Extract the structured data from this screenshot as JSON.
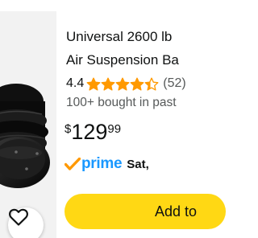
{
  "product": {
    "title_line1": "Universal 2600 lb",
    "title_line2": "Air Suspension Ba",
    "rating_value": "4.4",
    "rating_stars": 4.4,
    "review_count": "(52)",
    "bought_text": "100+ bought in past",
    "price": {
      "currency": "$",
      "whole": "129",
      "fraction": "99"
    },
    "prime_label": "prime",
    "delivery_text": "Sat,",
    "add_button_label": "Add to"
  },
  "colors": {
    "star": "#ff9900",
    "prime_blue": "#1a98ff",
    "prime_check": "#ff9900",
    "button_yellow": "#ffd814"
  },
  "icons": {
    "wishlist": "heart-outline-icon",
    "stars": "star-icon",
    "prime_check": "checkmark-icon"
  }
}
